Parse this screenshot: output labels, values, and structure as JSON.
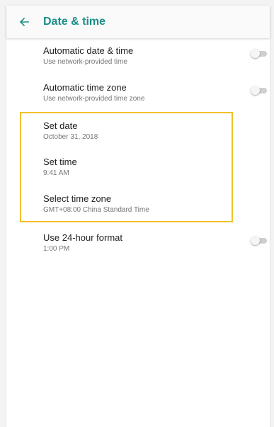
{
  "header": {
    "title": "Date & time",
    "back_icon": "arrow-back-icon",
    "accent_color": "#1d8e88"
  },
  "settings": [
    {
      "title": "Automatic date & time",
      "summary": "Use network-provided time",
      "toggle": false
    },
    {
      "title": "Automatic time zone",
      "summary": "Use network-provided time zone",
      "toggle": false
    },
    {
      "title": "Set date",
      "summary": "October 31, 2018"
    },
    {
      "title": "Set time",
      "summary": "9:41 AM"
    },
    {
      "title": "Select time zone",
      "summary": "GMT+08:00 China Standard Time"
    },
    {
      "title": "Use 24-hour format",
      "summary": "1:00 PM",
      "toggle": false
    }
  ],
  "highlight_color": "#f3c02a"
}
